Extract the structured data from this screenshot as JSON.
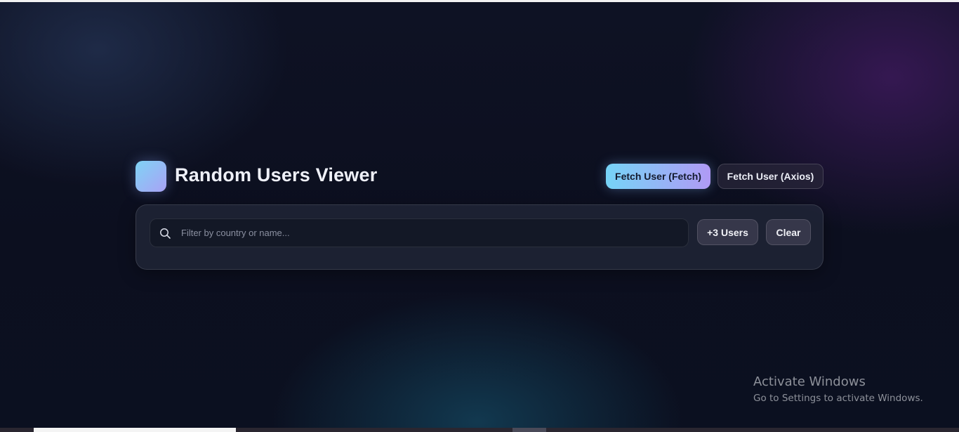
{
  "app": {
    "title": "Random Users Viewer"
  },
  "header": {
    "fetch_button_label": "Fetch User (Fetch)",
    "axios_button_label": "Fetch User (Axios)"
  },
  "toolbar": {
    "search_placeholder": "Filter by country or name...",
    "search_value": "",
    "add_users_label": "+3 Users",
    "clear_label": "Clear"
  },
  "watermark": {
    "title": "Activate Windows",
    "subtitle": "Go to Settings to activate Windows."
  },
  "colors": {
    "accent_gradient_start": "#76d4f7",
    "accent_gradient_end": "#b09af5",
    "background": "#0c0f1f"
  },
  "icons": {
    "search": "search-icon"
  }
}
